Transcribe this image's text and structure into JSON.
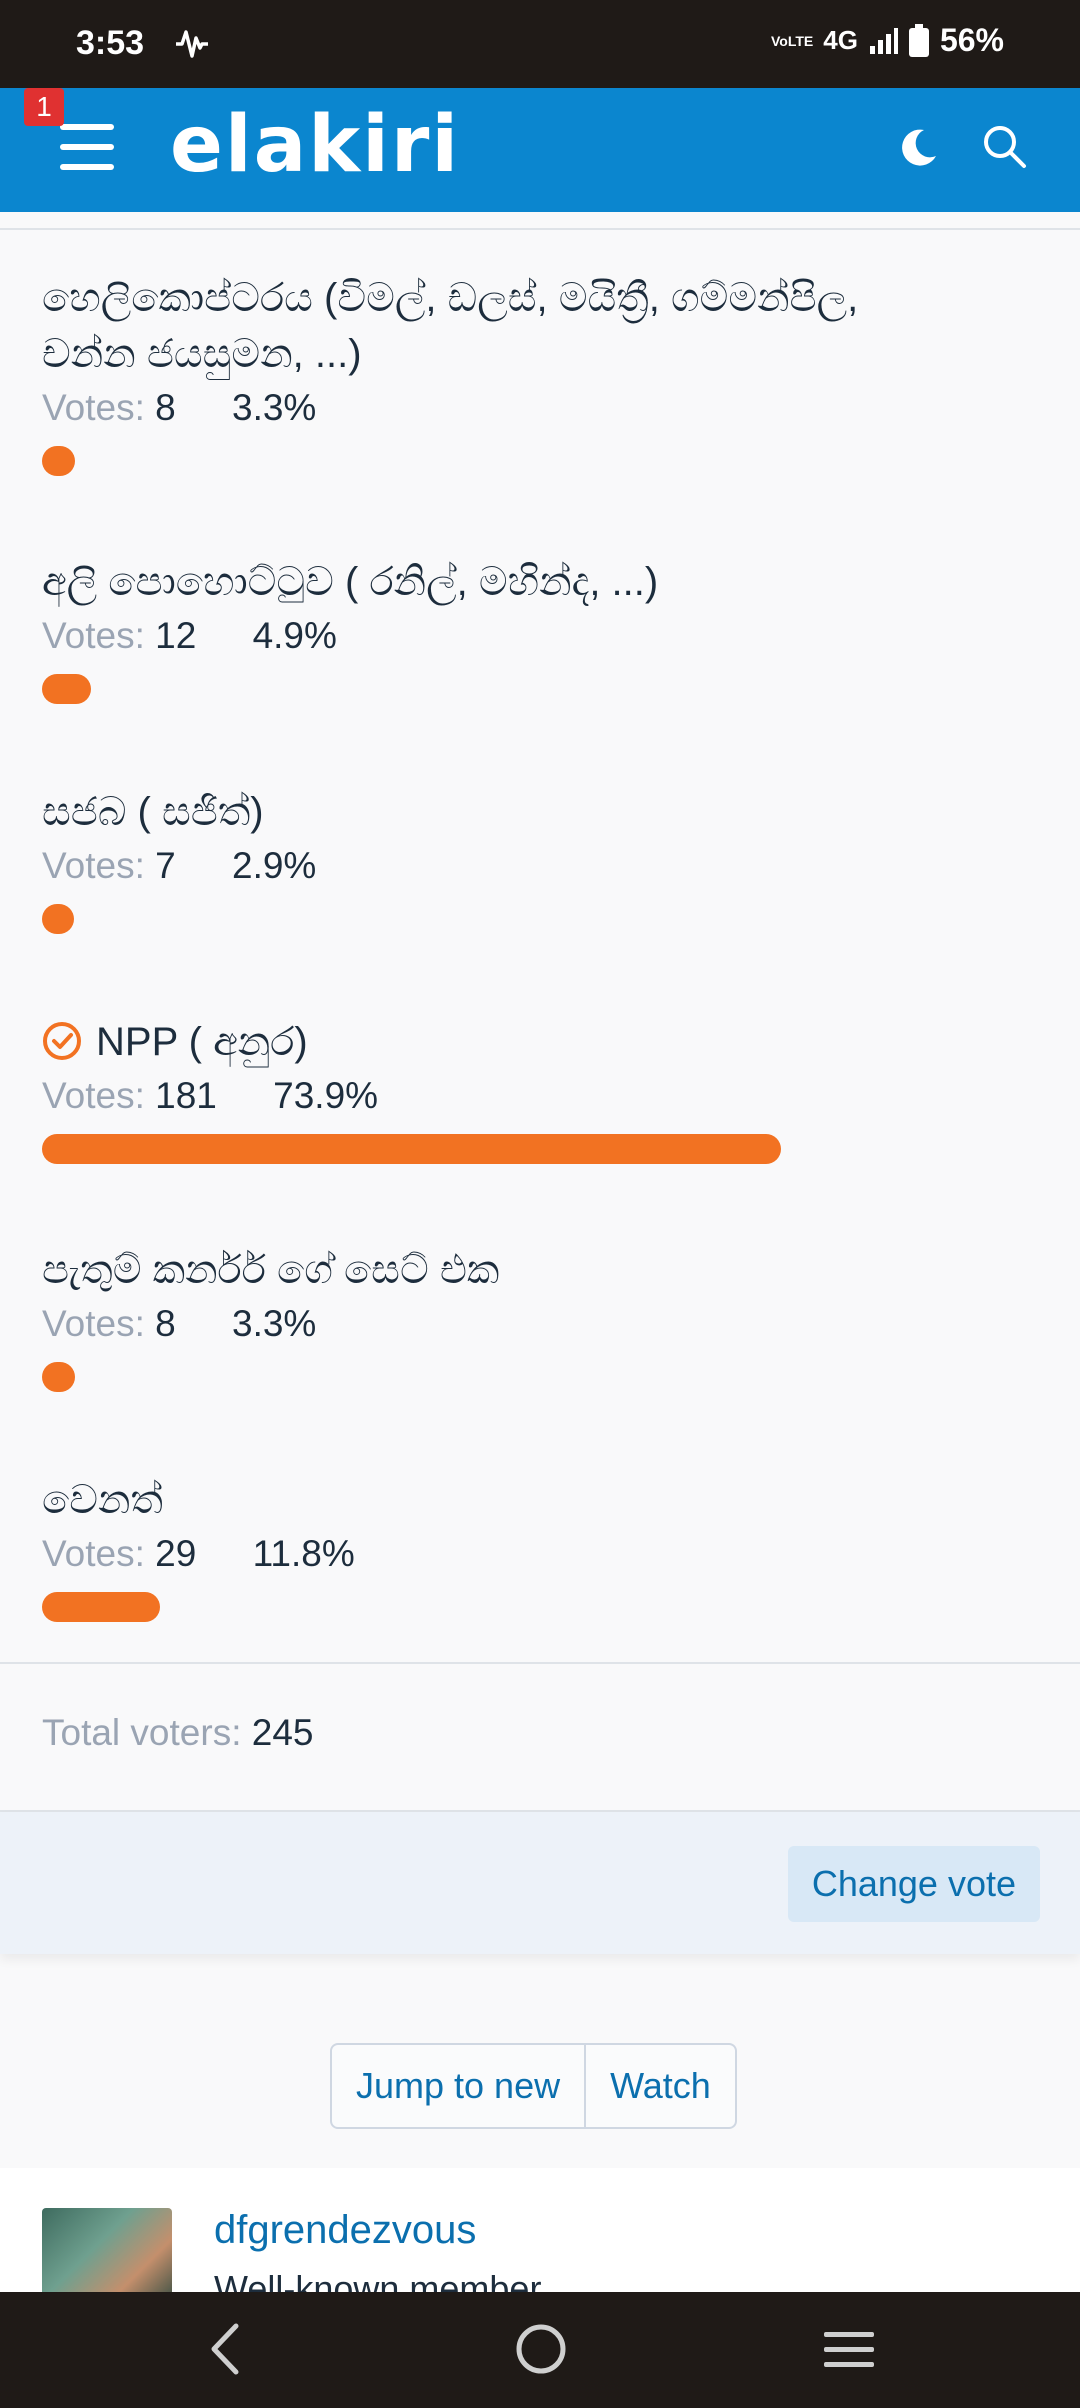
{
  "status_bar": {
    "time": "3:53",
    "network": "4G",
    "volte": "VoLTE",
    "battery": "56%"
  },
  "header": {
    "logo": "elakiri",
    "notification_count": "1"
  },
  "poll": {
    "options": [
      {
        "label_line1": "හෙලිකොප්ටරය (විමල්, ඩලස්, මයිත්‍රී, ගම්මන්පිල,",
        "label_line2": "චන්න ජයසුමන, ...)",
        "votes_label": "Votes:",
        "votes": "8",
        "percent": "3.3%",
        "fraction": 0.033
      },
      {
        "label_line1": "අලි පොහොට්ටුව ( රනිල්, මහින්ද, ...)",
        "votes_label": "Votes:",
        "votes": "12",
        "percent": "4.9%",
        "fraction": 0.049
      },
      {
        "label_line1": "සජබ ( සජිත්)",
        "votes_label": "Votes:",
        "votes": "7",
        "percent": "2.9%",
        "fraction": 0.029
      },
      {
        "label_line1": "NPP ( අනුර)",
        "votes_label": "Votes:",
        "votes": "181",
        "percent": "73.9%",
        "fraction": 0.739,
        "selected": true
      },
      {
        "label_line1": "පැතුම් කර්නර් ගේ සෙට් එක",
        "votes_label": "Votes:",
        "votes": "8",
        "percent": "3.3%",
        "fraction": 0.033
      },
      {
        "label_line1": "වෙනත්",
        "votes_label": "Votes:",
        "votes": "29",
        "percent": "11.8%",
        "fraction": 0.118
      }
    ],
    "total_label": "Total voters:",
    "total_value": "245",
    "change_vote": "Change vote",
    "bar_color": "#f27222"
  },
  "actions": {
    "jump_to_new": "Jump to new",
    "watch": "Watch"
  },
  "post": {
    "username": "dfgrendezvous",
    "user_title": "Well-known member"
  },
  "colors": {
    "header": "#0b86cf",
    "accent": "#f27222",
    "link": "#0b6fae"
  }
}
